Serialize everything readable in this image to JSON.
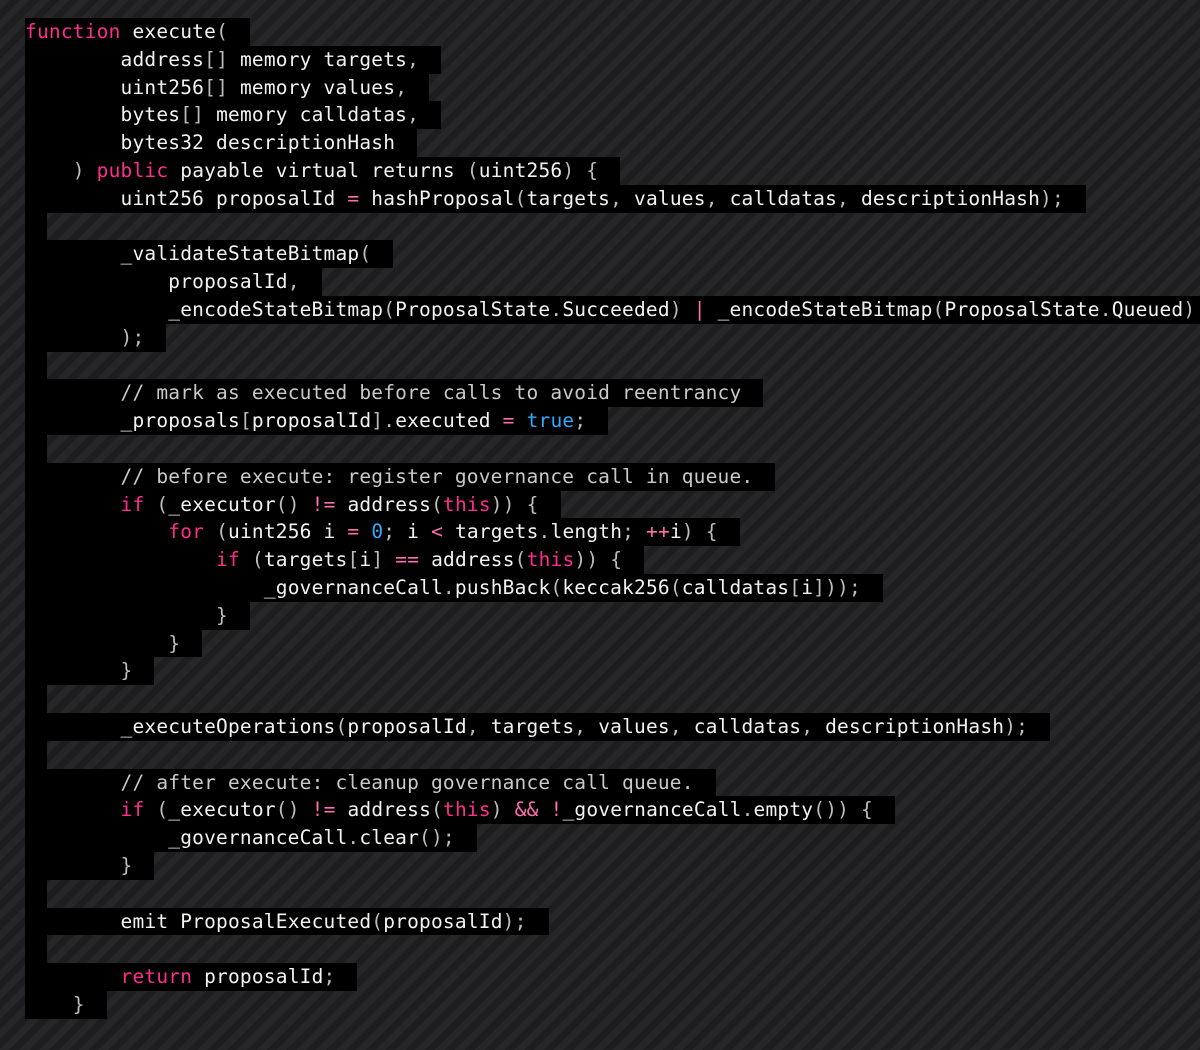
{
  "code": {
    "language": "solidity",
    "lines": [
      {
        "text": "function execute(",
        "tokens": [
          {
            "t": "function",
            "k": "kw"
          },
          {
            "t": " ",
            "k": "ws"
          },
          {
            "t": "execute",
            "k": "fn"
          },
          {
            "t": "(",
            "k": "pn"
          }
        ]
      },
      {
        "text": "        address[] memory targets,",
        "tokens": [
          {
            "t": "        ",
            "k": "ws"
          },
          {
            "t": "address",
            "k": "id"
          },
          {
            "t": "[]",
            "k": "pn"
          },
          {
            "t": " memory targets",
            "k": "id"
          },
          {
            "t": ",",
            "k": "pn"
          }
        ]
      },
      {
        "text": "        uint256[] memory values,",
        "tokens": [
          {
            "t": "        ",
            "k": "ws"
          },
          {
            "t": "uint256",
            "k": "id"
          },
          {
            "t": "[]",
            "k": "pn"
          },
          {
            "t": " memory values",
            "k": "id"
          },
          {
            "t": ",",
            "k": "pn"
          }
        ]
      },
      {
        "text": "        bytes[] memory calldatas,",
        "tokens": [
          {
            "t": "        ",
            "k": "ws"
          },
          {
            "t": "bytes",
            "k": "id"
          },
          {
            "t": "[]",
            "k": "pn"
          },
          {
            "t": " memory calldatas",
            "k": "id"
          },
          {
            "t": ",",
            "k": "pn"
          }
        ]
      },
      {
        "text": "        bytes32 descriptionHash",
        "tokens": [
          {
            "t": "        ",
            "k": "ws"
          },
          {
            "t": "bytes32 descriptionHash",
            "k": "id"
          }
        ]
      },
      {
        "text": "    ) public payable virtual returns (uint256) {",
        "tokens": [
          {
            "t": "    ",
            "k": "ws"
          },
          {
            "t": ")",
            "k": "pn"
          },
          {
            "t": " ",
            "k": "ws"
          },
          {
            "t": "public",
            "k": "kw"
          },
          {
            "t": " payable virtual returns ",
            "k": "id"
          },
          {
            "t": "(",
            "k": "pn"
          },
          {
            "t": "uint256",
            "k": "id"
          },
          {
            "t": ")",
            "k": "pn"
          },
          {
            "t": " ",
            "k": "ws"
          },
          {
            "t": "{",
            "k": "pn"
          }
        ]
      },
      {
        "text": "        uint256 proposalId = hashProposal(targets, values, calldatas, descriptionHash);",
        "tokens": [
          {
            "t": "        ",
            "k": "ws"
          },
          {
            "t": "uint256 proposalId ",
            "k": "id"
          },
          {
            "t": "=",
            "k": "op"
          },
          {
            "t": " hashProposal",
            "k": "id"
          },
          {
            "t": "(",
            "k": "pn"
          },
          {
            "t": "targets",
            "k": "id"
          },
          {
            "t": ",",
            "k": "pn"
          },
          {
            "t": " values",
            "k": "id"
          },
          {
            "t": ",",
            "k": "pn"
          },
          {
            "t": " calldatas",
            "k": "id"
          },
          {
            "t": ",",
            "k": "pn"
          },
          {
            "t": " descriptionHash",
            "k": "id"
          },
          {
            "t": ");",
            "k": "pn"
          }
        ]
      },
      {
        "text": "",
        "tokens": []
      },
      {
        "text": "        _validateStateBitmap(",
        "tokens": [
          {
            "t": "        ",
            "k": "ws"
          },
          {
            "t": "_validateStateBitmap",
            "k": "id"
          },
          {
            "t": "(",
            "k": "pn"
          }
        ]
      },
      {
        "text": "            proposalId,",
        "tokens": [
          {
            "t": "            ",
            "k": "ws"
          },
          {
            "t": "proposalId",
            "k": "id"
          },
          {
            "t": ",",
            "k": "pn"
          }
        ]
      },
      {
        "text": "            _encodeStateBitmap(ProposalState.Succeeded) | _encodeStateBitmap(ProposalState.Queued)",
        "tokens": [
          {
            "t": "            ",
            "k": "ws"
          },
          {
            "t": "_encodeStateBitmap",
            "k": "id"
          },
          {
            "t": "(",
            "k": "pn"
          },
          {
            "t": "ProposalState",
            "k": "id"
          },
          {
            "t": ".",
            "k": "pn"
          },
          {
            "t": "Succeeded",
            "k": "id"
          },
          {
            "t": ")",
            "k": "pn"
          },
          {
            "t": " ",
            "k": "ws"
          },
          {
            "t": "|",
            "k": "op"
          },
          {
            "t": " _encodeStateBitmap",
            "k": "id"
          },
          {
            "t": "(",
            "k": "pn"
          },
          {
            "t": "ProposalState",
            "k": "id"
          },
          {
            "t": ".",
            "k": "pn"
          },
          {
            "t": "Queued",
            "k": "id"
          },
          {
            "t": ")",
            "k": "pn"
          }
        ]
      },
      {
        "text": "        );",
        "tokens": [
          {
            "t": "        ",
            "k": "ws"
          },
          {
            "t": ");",
            "k": "pn"
          }
        ]
      },
      {
        "text": "",
        "tokens": []
      },
      {
        "text": "        // mark as executed before calls to avoid reentrancy",
        "tokens": [
          {
            "t": "        ",
            "k": "ws"
          },
          {
            "t": "// mark as executed before calls to avoid reentrancy",
            "k": "cm"
          }
        ]
      },
      {
        "text": "        _proposals[proposalId].executed = true;",
        "tokens": [
          {
            "t": "        ",
            "k": "ws"
          },
          {
            "t": "_proposals",
            "k": "id"
          },
          {
            "t": "[",
            "k": "pn"
          },
          {
            "t": "proposalId",
            "k": "id"
          },
          {
            "t": "]",
            "k": "pn"
          },
          {
            "t": ".",
            "k": "pn"
          },
          {
            "t": "executed ",
            "k": "id"
          },
          {
            "t": "=",
            "k": "op"
          },
          {
            "t": " ",
            "k": "ws"
          },
          {
            "t": "true",
            "k": "bl"
          },
          {
            "t": ";",
            "k": "pn"
          }
        ]
      },
      {
        "text": "",
        "tokens": []
      },
      {
        "text": "        // before execute: register governance call in queue.",
        "tokens": [
          {
            "t": "        ",
            "k": "ws"
          },
          {
            "t": "// before execute: register governance call in queue.",
            "k": "cm"
          }
        ]
      },
      {
        "text": "        if (_executor() != address(this)) {",
        "tokens": [
          {
            "t": "        ",
            "k": "ws"
          },
          {
            "t": "if",
            "k": "kw"
          },
          {
            "t": " ",
            "k": "ws"
          },
          {
            "t": "(",
            "k": "pn"
          },
          {
            "t": "_executor",
            "k": "id"
          },
          {
            "t": "()",
            "k": "pn"
          },
          {
            "t": " ",
            "k": "ws"
          },
          {
            "t": "!=",
            "k": "op"
          },
          {
            "t": " address",
            "k": "id"
          },
          {
            "t": "(",
            "k": "pn"
          },
          {
            "t": "this",
            "k": "kw"
          },
          {
            "t": "))",
            "k": "pn"
          },
          {
            "t": " ",
            "k": "ws"
          },
          {
            "t": "{",
            "k": "pn"
          }
        ]
      },
      {
        "text": "            for (uint256 i = 0; i < targets.length; ++i) {",
        "tokens": [
          {
            "t": "            ",
            "k": "ws"
          },
          {
            "t": "for",
            "k": "kw"
          },
          {
            "t": " ",
            "k": "ws"
          },
          {
            "t": "(",
            "k": "pn"
          },
          {
            "t": "uint256 i ",
            "k": "id"
          },
          {
            "t": "=",
            "k": "op"
          },
          {
            "t": " ",
            "k": "ws"
          },
          {
            "t": "0",
            "k": "num"
          },
          {
            "t": ";",
            "k": "pn"
          },
          {
            "t": " i ",
            "k": "id"
          },
          {
            "t": "<",
            "k": "op"
          },
          {
            "t": " targets",
            "k": "id"
          },
          {
            "t": ".",
            "k": "pn"
          },
          {
            "t": "length",
            "k": "id"
          },
          {
            "t": ";",
            "k": "pn"
          },
          {
            "t": " ",
            "k": "ws"
          },
          {
            "t": "++",
            "k": "op"
          },
          {
            "t": "i",
            "k": "id"
          },
          {
            "t": ")",
            "k": "pn"
          },
          {
            "t": " ",
            "k": "ws"
          },
          {
            "t": "{",
            "k": "pn"
          }
        ]
      },
      {
        "text": "                if (targets[i] == address(this)) {",
        "tokens": [
          {
            "t": "                ",
            "k": "ws"
          },
          {
            "t": "if",
            "k": "kw"
          },
          {
            "t": " ",
            "k": "ws"
          },
          {
            "t": "(",
            "k": "pn"
          },
          {
            "t": "targets",
            "k": "id"
          },
          {
            "t": "[",
            "k": "pn"
          },
          {
            "t": "i",
            "k": "id"
          },
          {
            "t": "]",
            "k": "pn"
          },
          {
            "t": " ",
            "k": "ws"
          },
          {
            "t": "==",
            "k": "op"
          },
          {
            "t": " address",
            "k": "id"
          },
          {
            "t": "(",
            "k": "pn"
          },
          {
            "t": "this",
            "k": "kw"
          },
          {
            "t": "))",
            "k": "pn"
          },
          {
            "t": " ",
            "k": "ws"
          },
          {
            "t": "{",
            "k": "pn"
          }
        ]
      },
      {
        "text": "                    _governanceCall.pushBack(keccak256(calldatas[i]));",
        "tokens": [
          {
            "t": "                    ",
            "k": "ws"
          },
          {
            "t": "_governanceCall",
            "k": "id"
          },
          {
            "t": ".",
            "k": "pn"
          },
          {
            "t": "pushBack",
            "k": "id"
          },
          {
            "t": "(",
            "k": "pn"
          },
          {
            "t": "keccak256",
            "k": "id"
          },
          {
            "t": "(",
            "k": "pn"
          },
          {
            "t": "calldatas",
            "k": "id"
          },
          {
            "t": "[",
            "k": "pn"
          },
          {
            "t": "i",
            "k": "id"
          },
          {
            "t": "]));",
            "k": "pn"
          }
        ]
      },
      {
        "text": "                }",
        "tokens": [
          {
            "t": "                ",
            "k": "ws"
          },
          {
            "t": "}",
            "k": "pn"
          }
        ]
      },
      {
        "text": "            }",
        "tokens": [
          {
            "t": "            ",
            "k": "ws"
          },
          {
            "t": "}",
            "k": "pn"
          }
        ]
      },
      {
        "text": "        }",
        "tokens": [
          {
            "t": "        ",
            "k": "ws"
          },
          {
            "t": "}",
            "k": "pn"
          }
        ]
      },
      {
        "text": "",
        "tokens": []
      },
      {
        "text": "        _executeOperations(proposalId, targets, values, calldatas, descriptionHash);",
        "tokens": [
          {
            "t": "        ",
            "k": "ws"
          },
          {
            "t": "_executeOperations",
            "k": "id"
          },
          {
            "t": "(",
            "k": "pn"
          },
          {
            "t": "proposalId",
            "k": "id"
          },
          {
            "t": ",",
            "k": "pn"
          },
          {
            "t": " targets",
            "k": "id"
          },
          {
            "t": ",",
            "k": "pn"
          },
          {
            "t": " values",
            "k": "id"
          },
          {
            "t": ",",
            "k": "pn"
          },
          {
            "t": " calldatas",
            "k": "id"
          },
          {
            "t": ",",
            "k": "pn"
          },
          {
            "t": " descriptionHash",
            "k": "id"
          },
          {
            "t": ");",
            "k": "pn"
          }
        ]
      },
      {
        "text": "",
        "tokens": []
      },
      {
        "text": "        // after execute: cleanup governance call queue.",
        "tokens": [
          {
            "t": "        ",
            "k": "ws"
          },
          {
            "t": "// after execute: cleanup governance call queue.",
            "k": "cm"
          }
        ]
      },
      {
        "text": "        if (_executor() != address(this) && !_governanceCall.empty()) {",
        "tokens": [
          {
            "t": "        ",
            "k": "ws"
          },
          {
            "t": "if",
            "k": "kw"
          },
          {
            "t": " ",
            "k": "ws"
          },
          {
            "t": "(",
            "k": "pn"
          },
          {
            "t": "_executor",
            "k": "id"
          },
          {
            "t": "()",
            "k": "pn"
          },
          {
            "t": " ",
            "k": "ws"
          },
          {
            "t": "!=",
            "k": "op"
          },
          {
            "t": " address",
            "k": "id"
          },
          {
            "t": "(",
            "k": "pn"
          },
          {
            "t": "this",
            "k": "kw"
          },
          {
            "t": ")",
            "k": "pn"
          },
          {
            "t": " ",
            "k": "ws"
          },
          {
            "t": "&&",
            "k": "op"
          },
          {
            "t": " ",
            "k": "ws"
          },
          {
            "t": "!",
            "k": "op"
          },
          {
            "t": "_governanceCall",
            "k": "id"
          },
          {
            "t": ".",
            "k": "pn"
          },
          {
            "t": "empty",
            "k": "id"
          },
          {
            "t": "())",
            "k": "pn"
          },
          {
            "t": " ",
            "k": "ws"
          },
          {
            "t": "{",
            "k": "pn"
          }
        ]
      },
      {
        "text": "            _governanceCall.clear();",
        "tokens": [
          {
            "t": "            ",
            "k": "ws"
          },
          {
            "t": "_governanceCall",
            "k": "id"
          },
          {
            "t": ".",
            "k": "pn"
          },
          {
            "t": "clear",
            "k": "id"
          },
          {
            "t": "();",
            "k": "pn"
          }
        ]
      },
      {
        "text": "        }",
        "tokens": [
          {
            "t": "        ",
            "k": "ws"
          },
          {
            "t": "}",
            "k": "pn"
          }
        ]
      },
      {
        "text": "",
        "tokens": []
      },
      {
        "text": "        emit ProposalExecuted(proposalId);",
        "tokens": [
          {
            "t": "        ",
            "k": "ws"
          },
          {
            "t": "emit ProposalExecuted",
            "k": "id"
          },
          {
            "t": "(",
            "k": "pn"
          },
          {
            "t": "proposalId",
            "k": "id"
          },
          {
            "t": ");",
            "k": "pn"
          }
        ]
      },
      {
        "text": "",
        "tokens": []
      },
      {
        "text": "        return proposalId;",
        "tokens": [
          {
            "t": "        ",
            "k": "ws"
          },
          {
            "t": "return",
            "k": "kw"
          },
          {
            "t": " proposalId",
            "k": "id"
          },
          {
            "t": ";",
            "k": "pn"
          }
        ]
      },
      {
        "text": "    }",
        "tokens": [
          {
            "t": "    ",
            "k": "ws"
          },
          {
            "t": "}",
            "k": "pn"
          }
        ]
      }
    ]
  }
}
